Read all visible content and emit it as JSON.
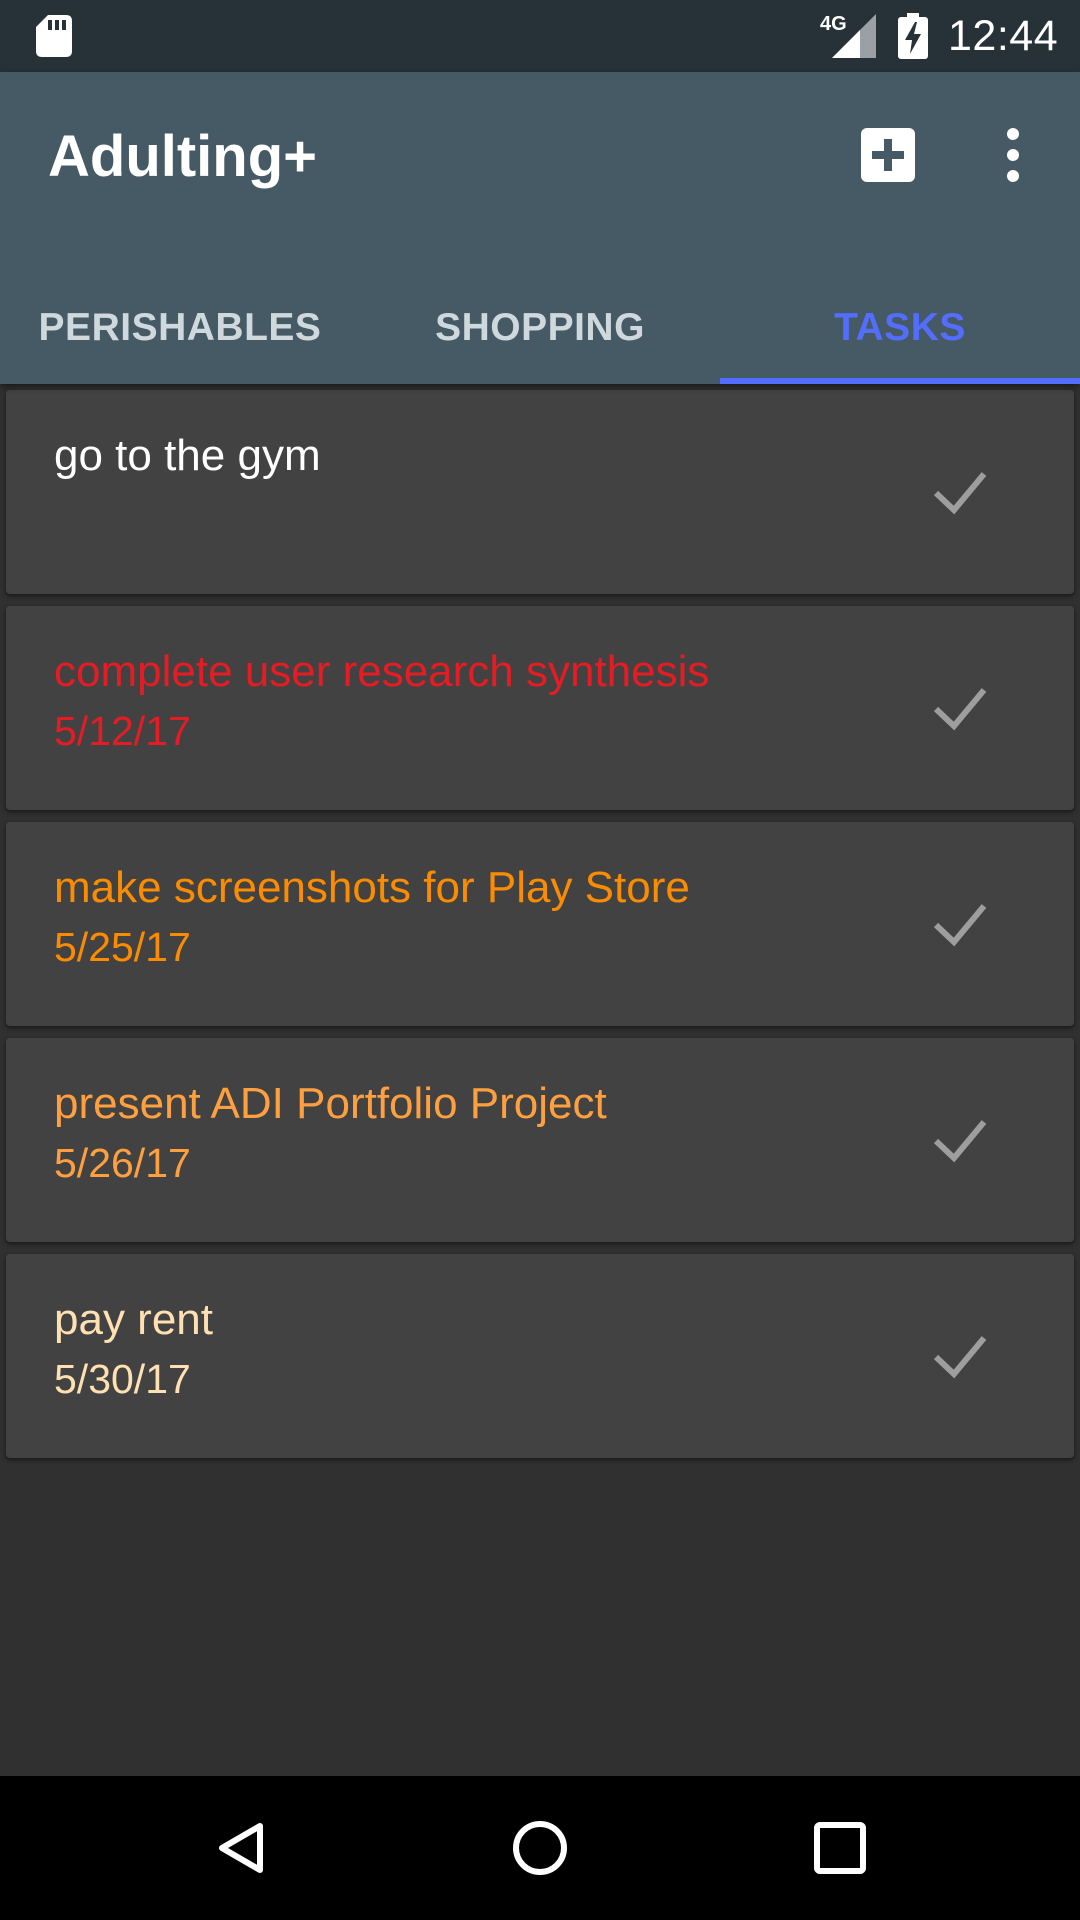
{
  "status_bar": {
    "network_label": "4G",
    "time": "12:44",
    "icons": [
      "sd-card-icon",
      "signal-icon",
      "battery-charging-icon"
    ]
  },
  "app_bar": {
    "title": "Adulting+",
    "actions": [
      "add-box-icon",
      "more-vert-icon"
    ]
  },
  "tabs": [
    {
      "label": "PERISHABLES",
      "active": false
    },
    {
      "label": "SHOPPING",
      "active": false
    },
    {
      "label": "TASKS",
      "active": true
    }
  ],
  "tasks": [
    {
      "title": "go to the gym",
      "date": "",
      "color": "#ffffff"
    },
    {
      "title": "complete user research synthesis",
      "date": "5/12/17",
      "color": "#e51c23"
    },
    {
      "title": "make screenshots for Play Store",
      "date": "5/25/17",
      "color": "#fb8c00"
    },
    {
      "title": "present ADI Portfolio Project",
      "date": "5/26/17",
      "color": "#ffa040"
    },
    {
      "title": "pay rent",
      "date": "5/30/17",
      "color": "#ffe0b2"
    }
  ],
  "colors": {
    "status_bar": "#263238",
    "app_bar": "#455a64",
    "accent": "#536dfe",
    "background": "#303030",
    "card": "#424242",
    "check_icon": "#9e9e9e"
  },
  "nav_bar": {
    "icons": [
      "back-icon",
      "home-icon",
      "recents-icon"
    ]
  }
}
